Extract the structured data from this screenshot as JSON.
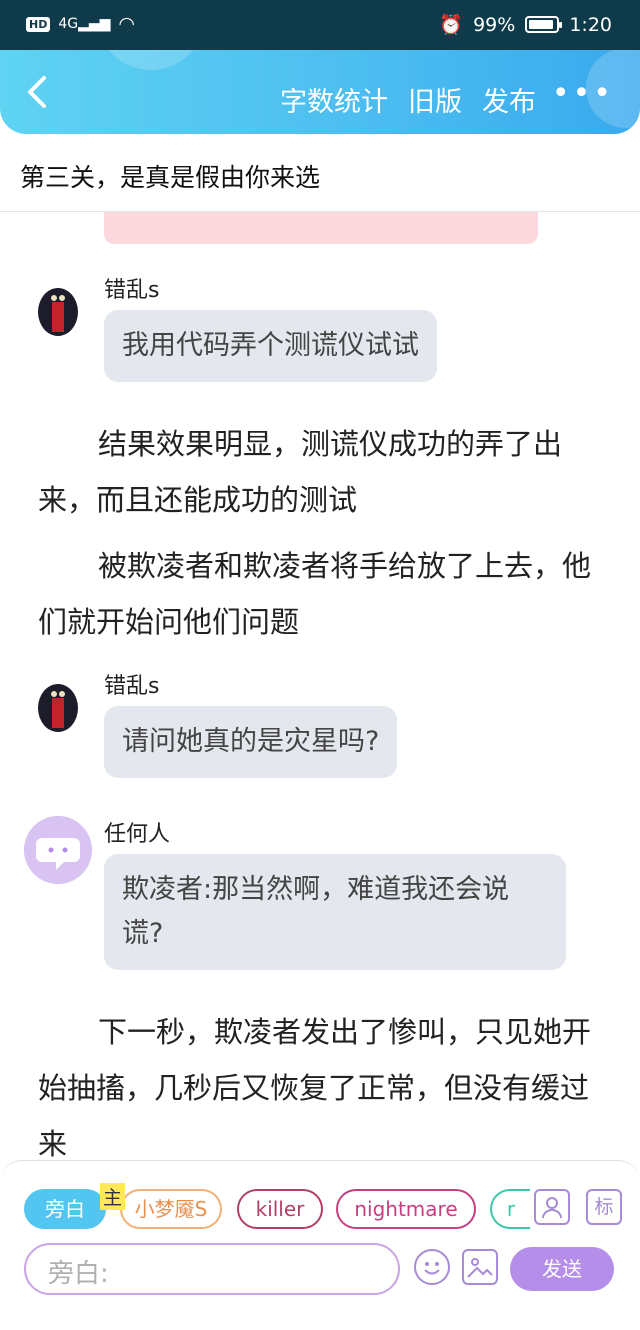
{
  "status": {
    "hd": "HD",
    "network": "4G",
    "battery": "99%",
    "time": "1:20"
  },
  "nav": {
    "word_count": "字数统计",
    "old_version": "旧版",
    "publish": "发布",
    "more": "•••"
  },
  "chapter_title": "第三关，是真是假由你来选",
  "messages": [
    {
      "speaker": "错乱s",
      "text": "我用代码弄个测谎仪试试"
    },
    {
      "narration": "结果效果明显，测谎仪成功的弄了出来，而且还能成功的测试"
    },
    {
      "narration": "被欺凌者和欺凌者将手给放了上去，他们就开始问他们问题"
    },
    {
      "speaker": "错乱s",
      "text": "请问她真的是灾星吗?"
    },
    {
      "speaker": "任何人",
      "text": "欺凌者:那当然啊，难道我还会说谎?"
    },
    {
      "narration": "下一秒，欺凌者发出了惨叫，只见她开始抽搐，几秒后又恢复了正常，但没有缓过来"
    }
  ],
  "composer": {
    "chips": [
      "旁白",
      "小梦魇S",
      "killer",
      "nightmare",
      "r"
    ],
    "main_tag": "主",
    "role_btn_icon": "person-icon",
    "tag_btn": "标",
    "input_placeholder": "旁白:",
    "send": "发送"
  },
  "colors": {
    "header": "#4bbcf0",
    "accent_purple": "#b48ee8",
    "bubble": "#e4e8ee"
  }
}
